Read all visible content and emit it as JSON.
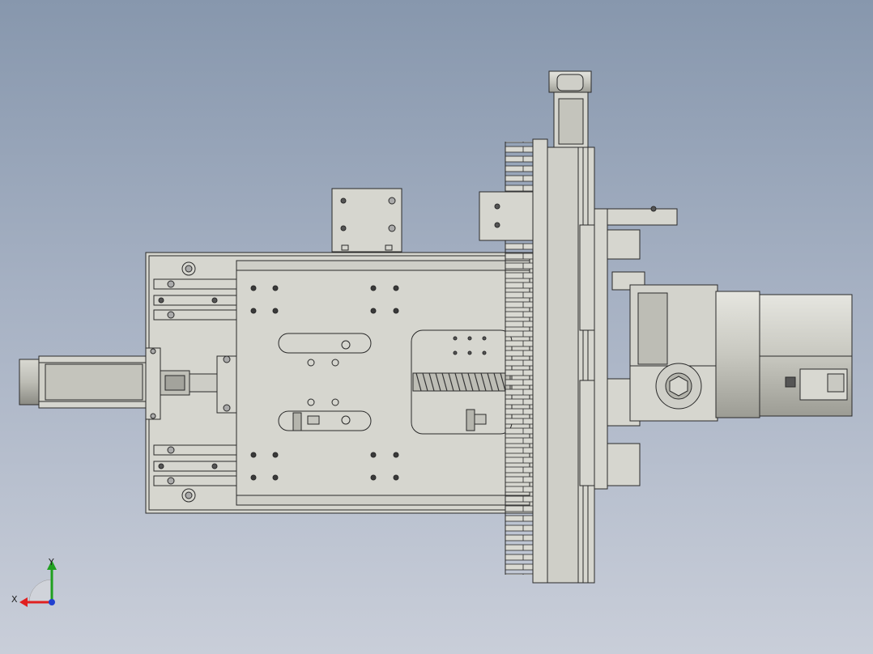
{
  "viewport": {
    "background_top": "#8797ad",
    "background_bottom": "#c9ced9"
  },
  "model": {
    "part_fill": "#d6d6cf",
    "part_fill_dark": "#a9a9a1",
    "edge_color": "#2a2a2a",
    "hole_color": "#3a3a3a"
  },
  "triad": {
    "x_label": "X",
    "y_label": "Y",
    "x_color": "#e02020",
    "y_color": "#20a020",
    "z_color": "#2040d0"
  }
}
